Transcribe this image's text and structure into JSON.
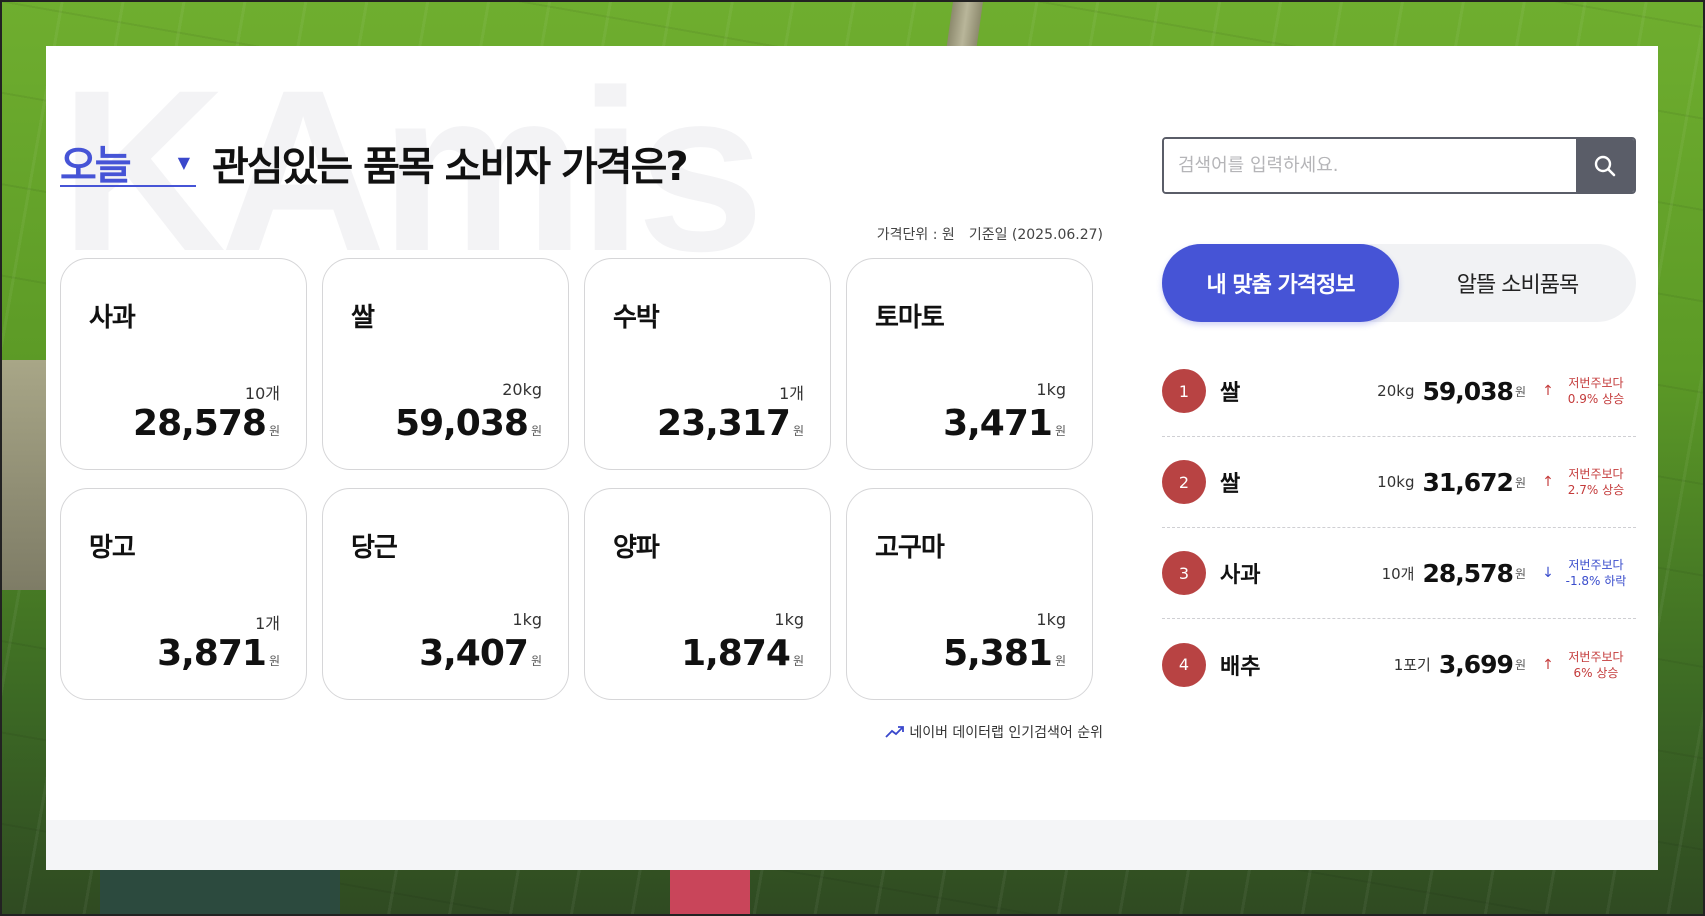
{
  "headline": {
    "period_value": "오늘",
    "title": "관심있는 품목 소비자 가격은?"
  },
  "watermark": "KAmis",
  "meta": {
    "unit_label": "가격단위 : 원",
    "base_date": "기준일 (2025.06.27)"
  },
  "currency_suffix": "원",
  "cards": [
    {
      "name": "사과",
      "unit": "10개",
      "price": "28,578"
    },
    {
      "name": "쌀",
      "unit": "20kg",
      "price": "59,038"
    },
    {
      "name": "수박",
      "unit": "1개",
      "price": "23,317"
    },
    {
      "name": "토마토",
      "unit": "1kg",
      "price": "3,471"
    },
    {
      "name": "망고",
      "unit": "1개",
      "price": "3,871"
    },
    {
      "name": "당근",
      "unit": "1kg",
      "price": "3,407"
    },
    {
      "name": "양파",
      "unit": "1kg",
      "price": "1,874"
    },
    {
      "name": "고구마",
      "unit": "1kg",
      "price": "5,381"
    }
  ],
  "naver_link": "네이버 데이터랩 인기검색어 순위",
  "search": {
    "placeholder": "검색어를 입력하세요.",
    "icon": "search-icon"
  },
  "tabs": [
    {
      "label": "내 맞춤 가격정보",
      "active": true
    },
    {
      "label": "알뜰 소비품목",
      "active": false
    }
  ],
  "ranking": [
    {
      "rank": "1",
      "name": "쌀",
      "unit": "20kg",
      "price": "59,038",
      "direction": "up",
      "change_label": "저번주보다",
      "change_value": "0.9% 상승"
    },
    {
      "rank": "2",
      "name": "쌀",
      "unit": "10kg",
      "price": "31,672",
      "direction": "up",
      "change_label": "저번주보다",
      "change_value": "2.7% 상승"
    },
    {
      "rank": "3",
      "name": "사과",
      "unit": "10개",
      "price": "28,578",
      "direction": "down",
      "change_label": "저번주보다",
      "change_value": "-1.8% 하락"
    },
    {
      "rank": "4",
      "name": "배추",
      "unit": "1포기",
      "price": "3,699",
      "direction": "up",
      "change_label": "저번주보다",
      "change_value": "6% 상승"
    }
  ],
  "colors": {
    "accent": "#4654d6",
    "rank_badge": "#b84343",
    "up": "#c43b3b",
    "down": "#3a4dcc"
  }
}
